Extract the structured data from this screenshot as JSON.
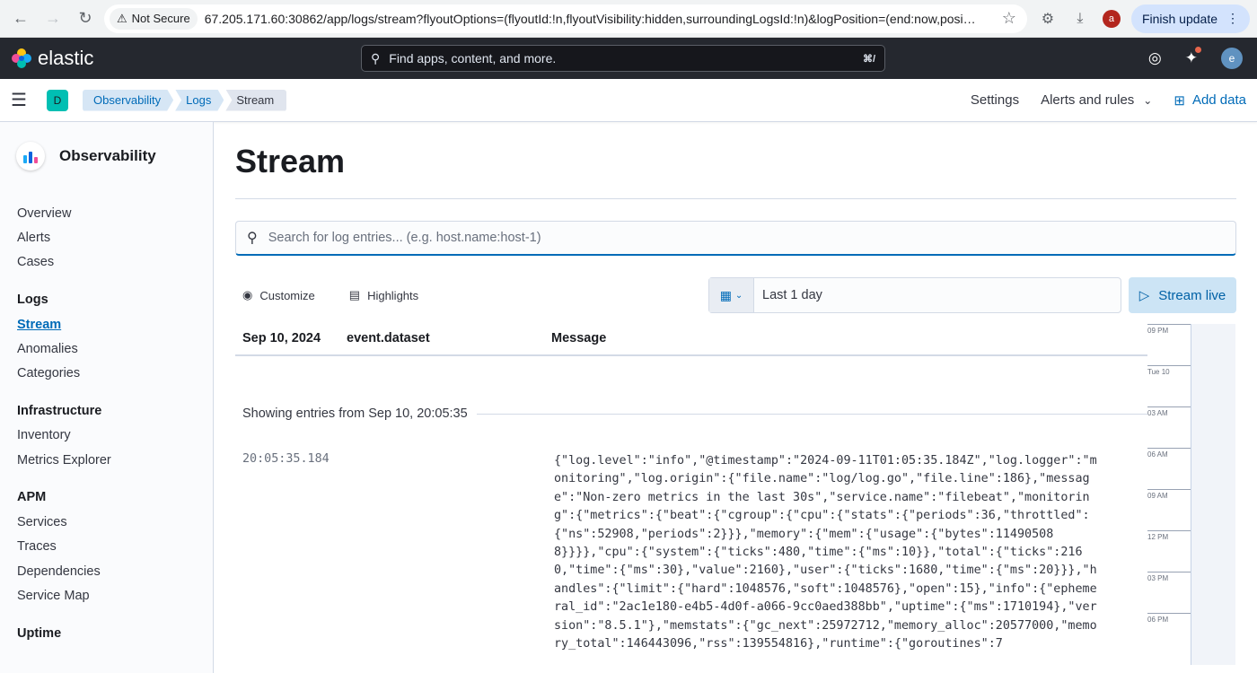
{
  "browser": {
    "security_label": "Not Secure",
    "url": "67.205.171.60:30862/app/logs/stream?flyoutOptions=(flyoutId:!n,flyoutVisibility:hidden,surroundingLogsId:!n)&logPosition=(end:now,posi…",
    "profile_initial": "a",
    "finish_update_label": "Finish update"
  },
  "header": {
    "brand": "elastic",
    "search_placeholder": "Find apps, content, and more.",
    "search_shortcut": "⌘/",
    "user_initial": "e"
  },
  "breadcrumb_bar": {
    "space_initial": "D",
    "crumbs": [
      "Observability",
      "Logs",
      "Stream"
    ],
    "settings_label": "Settings",
    "alerts_label": "Alerts and rules",
    "add_data_label": "Add data"
  },
  "sidebar": {
    "title": "Observability",
    "items": [
      "Overview",
      "Alerts",
      "Cases"
    ],
    "logs_heading": "Logs",
    "logs_items": [
      "Stream",
      "Anomalies",
      "Categories"
    ],
    "infra_heading": "Infrastructure",
    "infra_items": [
      "Inventory",
      "Metrics Explorer"
    ],
    "apm_heading": "APM",
    "apm_items": [
      "Services",
      "Traces",
      "Dependencies",
      "Service Map"
    ],
    "uptime_heading": "Uptime"
  },
  "page": {
    "title": "Stream",
    "search_placeholder": "Search for log entries... (e.g. host.name:host-1)",
    "customize_label": "Customize",
    "highlights_label": "Highlights",
    "date_range": "Last 1 day",
    "stream_live_label": "Stream live"
  },
  "log_table": {
    "columns": [
      "Sep 10, 2024",
      "event.dataset",
      "Message"
    ],
    "showing_text": "Showing entries from Sep 10, 20:05:35",
    "entries": [
      {
        "time": "20:05:35.184",
        "message": "{\"log.level\":\"info\",\"@timestamp\":\"2024-09-11T01:05:35.184Z\",\"log.logger\":\"monitoring\",\"log.origin\":{\"file.name\":\"log/log.go\",\"file.line\":186},\"message\":\"Non-zero metrics in the last 30s\",\"service.name\":\"filebeat\",\"monitoring\":{\"metrics\":{\"beat\":{\"cgroup\":{\"cpu\":{\"stats\":{\"periods\":36,\"throttled\":{\"ns\":52908,\"periods\":2}}},\"memory\":{\"mem\":{\"usage\":{\"bytes\":114905088}}}},\"cpu\":{\"system\":{\"ticks\":480,\"time\":{\"ms\":10}},\"total\":{\"ticks\":2160,\"time\":{\"ms\":30},\"value\":2160},\"user\":{\"ticks\":1680,\"time\":{\"ms\":20}}},\"handles\":{\"limit\":{\"hard\":1048576,\"soft\":1048576},\"open\":15},\"info\":{\"ephemeral_id\":\"2ac1e180-e4b5-4d0f-a066-9cc0aed388bb\",\"uptime\":{\"ms\":1710194},\"version\":\"8.5.1\"},\"memstats\":{\"gc_next\":25972712,\"memory_alloc\":20577000,\"memory_total\":146443096,\"rss\":139554816},\"runtime\":{\"goroutines\":7"
      }
    ]
  },
  "minimap": {
    "ticks": [
      "09 PM",
      "Tue 10",
      "03 AM",
      "06 AM",
      "09 AM",
      "12 PM",
      "03 PM",
      "06 PM"
    ]
  }
}
